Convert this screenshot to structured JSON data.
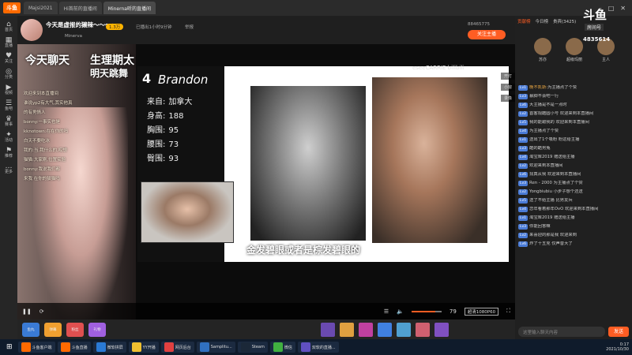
{
  "browser": {
    "logo": "斗鱼",
    "tabs": [
      {
        "label": "Majsi2021",
        "active": false
      },
      {
        "label": "Hi首前的直播间",
        "active": false
      },
      {
        "label": "Minerna听的直播间",
        "active": true
      }
    ]
  },
  "leftnav": [
    {
      "icon": "⌂",
      "label": "首页"
    },
    {
      "icon": "▦",
      "label": "直播"
    },
    {
      "icon": "♥",
      "label": "关注"
    },
    {
      "icon": "◎",
      "label": "分类"
    },
    {
      "icon": "▶",
      "label": "视频"
    },
    {
      "icon": "☰",
      "label": "鱼吧"
    },
    {
      "icon": "♛",
      "label": "赛事"
    },
    {
      "icon": "✦",
      "label": "活动"
    },
    {
      "icon": "⚑",
      "label": "推荐"
    },
    {
      "icon": "…",
      "label": "更多"
    }
  ],
  "header": {
    "title": "今天是虚报的獭辣～～～～",
    "tag_follow": "关注",
    "fans": "1.3万",
    "meta1": "已播出1小时9分钟",
    "meta2": "举报",
    "streamer": "Minerva",
    "room_label": "88465775",
    "follow_button": "关注主播"
  },
  "overlay": {
    "big_left": "今天聊天",
    "big_right": "生理期太",
    "big_right2": "明天跳舞",
    "lines": [
      "欢迎来到本直播间",
      "谁说yp2有大气,其实他真",
      "的有男情人",
      "bonny:一事实也是",
      "kknotown:在在你的吗",
      "白天不要吃冰",
      "我的:当,我什么的,哎想",
      "猫猫:大家刚,位置实验",
      "bonny:我说我们都",
      "来我 在你的猫猫吗"
    ]
  },
  "slide": {
    "number": "4",
    "name": "Brandon",
    "stats": [
      {
        "k": "来自:",
        "v": "加拿大"
      },
      {
        "k": "身高:",
        "v": "188"
      },
      {
        "k": "胸围:",
        "v": "95"
      },
      {
        "k": "腰围:",
        "v": "73"
      },
      {
        "k": "臀围:",
        "v": "93"
      }
    ],
    "watermark": "eseeCARRIE bilibili"
  },
  "subtitle": "金发碧眼或者是棕发碧眼的",
  "side_tools": [
    "开灯",
    "小窗",
    "录像"
  ],
  "controls": {
    "volume_label": "79",
    "volume_level": 0.79,
    "quality": "超清1080P60",
    "fullscreen": "⛶"
  },
  "gifts": [
    {
      "label": "鱼丸",
      "color": "#3a7bd5"
    },
    {
      "label": "弹幕",
      "color": "#f0a030"
    },
    {
      "label": "粉丝",
      "color": "#e05050"
    },
    {
      "label": "礼物",
      "color": "#a060e0"
    }
  ],
  "gift_thumbs": [
    "#6a4ab0",
    "#e0a040",
    "#c040a0",
    "#4080e0",
    "#50a0d0",
    "#d06070",
    "#8050c0"
  ],
  "right": {
    "douyu": "斗鱼",
    "room_label": "房间号",
    "room_no": "4835614",
    "rank_tabs": [
      {
        "label": "贡献榜",
        "on": true
      },
      {
        "label": "今日榜",
        "on": false
      },
      {
        "label": "贵宾(3425)",
        "on": false
      }
    ],
    "rankers": [
      "苏亦",
      "超级玛丽",
      "主人"
    ],
    "chat": [
      {
        "lvl": "Lv1",
        "nick": "晚不凯斯:",
        "text": "为主播点了个赞"
      },
      {
        "lvl": "Lv3",
        "nick": "",
        "text": "暴脚不会吧一行"
      },
      {
        "lvl": "Lv6",
        "nick": "",
        "text": "大主播是不是一点时"
      },
      {
        "lvl": "Lv2",
        "nick": "",
        "text": "首客观酷圆小号 欢迎来到本直播间"
      },
      {
        "lvl": "Lv5",
        "nick": "",
        "text": "我的能跟我的 欢迎来到本直播间"
      },
      {
        "lvl": "Lv4",
        "nick": "",
        "text": "为主播点了个赞"
      },
      {
        "lvl": "Lv1",
        "nick": "",
        "text": "送出了1个吸粉 粉这给主播"
      },
      {
        "lvl": "Lv3",
        "nick": "",
        "text": "酷的酷男兔"
      },
      {
        "lvl": "Lv4",
        "nick": "",
        "text": "淘宝库2019 赠送给主播"
      },
      {
        "lvl": "Lv2",
        "nick": "",
        "text": "欢迎来到本直播间"
      },
      {
        "lvl": "Lv6",
        "nick": "",
        "text": "找真从我 欢迎来到本直播间"
      },
      {
        "lvl": "Lv3",
        "nick": "",
        "text": "Ren - 2000 为主播点了个赞"
      },
      {
        "lvl": "Lv2",
        "nick": "",
        "text": "Yongbiubiu 小步子想个还送"
      },
      {
        "lvl": "Lv5",
        "nick": "",
        "text": "送了不给主播 比男友兵"
      },
      {
        "lvl": "Lv4",
        "nick": "",
        "text": "恋年看着那年OvO 欢迎来到本直播间"
      },
      {
        "lvl": "Lv1",
        "nick": "",
        "text": "淘宝库2019 赠送给主播"
      },
      {
        "lvl": "Lv3",
        "nick": "",
        "text": "你能回答嘛"
      },
      {
        "lvl": "Lv2",
        "nick": "",
        "text": "来喜迎的那是我 欢迎来到"
      },
      {
        "lvl": "Lv6",
        "nick": "",
        "text": "炸了十五克 仅声音大了"
      }
    ],
    "chat_placeholder": "这里输入聊天内容",
    "send_label": "发送"
  },
  "taskbar": {
    "apps": [
      {
        "label": "斗鱼客户端",
        "color": "#ff6a00"
      },
      {
        "label": "斗鱼直播",
        "color": "#ff6a00"
      },
      {
        "label": "微软拼屏",
        "color": "#2a7ad5"
      },
      {
        "label": "YY开播",
        "color": "#f0c030"
      },
      {
        "label": "网页后台",
        "color": "#e04040"
      },
      {
        "label": "Samplitu...",
        "color": "#3070c0"
      },
      {
        "label": "Steam",
        "color": "#1b2838"
      },
      {
        "label": "微信",
        "color": "#40b040"
      },
      {
        "label": "双软的直播...",
        "color": "#6050c0"
      }
    ],
    "time": "0:17",
    "date": "2021/10/30"
  }
}
